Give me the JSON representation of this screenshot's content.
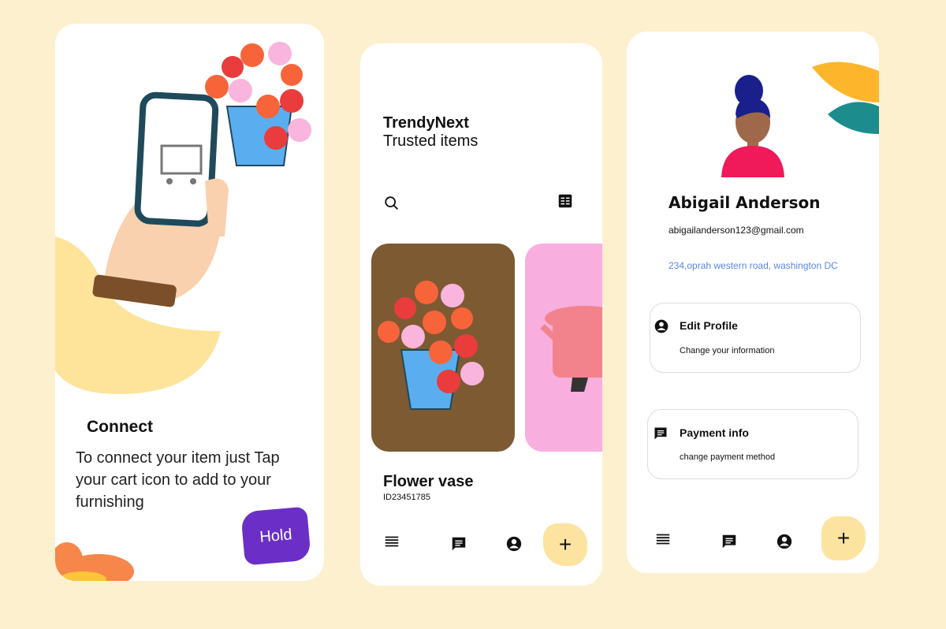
{
  "onboarding": {
    "title": "Connect",
    "description": "To connect your item just Tap your cart icon to add to your furnishing",
    "hold_button": "Hold",
    "accent": "#6b2fc7"
  },
  "shop": {
    "brand": "TrendyNext",
    "tagline": "Trusted items",
    "product": {
      "name": "Flower vase",
      "id": "ID23451785"
    },
    "nav": [
      "menu-icon",
      "chat-icon",
      "account-icon",
      "plus-icon"
    ],
    "add_label": "+"
  },
  "profile": {
    "name": "Abigail  Anderson",
    "email": "abigailanderson123@gmail.com",
    "address": "234,oprah western road, washington DC",
    "address_color": "#5b86e5",
    "options": [
      {
        "title": "Edit Profile",
        "subtitle": "Change your information"
      },
      {
        "title": "Payment info",
        "subtitle": "change payment method"
      }
    ],
    "add_label": "+"
  }
}
